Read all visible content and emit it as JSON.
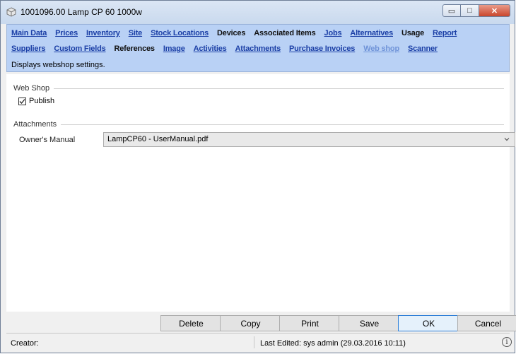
{
  "window": {
    "title": "1001096.00 Lamp CP 60 1000w",
    "controls": {
      "minimize": "▭",
      "maximize": "□",
      "close": "✕"
    }
  },
  "nav": {
    "row1": [
      {
        "label": "Main Data",
        "style": "link"
      },
      {
        "label": "Prices",
        "style": "link"
      },
      {
        "label": "Inventory",
        "style": "link"
      },
      {
        "label": "Site",
        "style": "link"
      },
      {
        "label": "Stock Locations",
        "style": "link"
      },
      {
        "label": "Devices",
        "style": "plain"
      },
      {
        "label": "Associated Items",
        "style": "plain"
      },
      {
        "label": "Jobs",
        "style": "link"
      },
      {
        "label": "Alternatives",
        "style": "link"
      },
      {
        "label": "Usage",
        "style": "plain"
      },
      {
        "label": "Report",
        "style": "link"
      }
    ],
    "row2": [
      {
        "label": "Suppliers",
        "style": "link"
      },
      {
        "label": "Custom Fields",
        "style": "link"
      },
      {
        "label": "References",
        "style": "plain"
      },
      {
        "label": "Image",
        "style": "link"
      },
      {
        "label": "Activities",
        "style": "link"
      },
      {
        "label": "Attachments",
        "style": "link"
      },
      {
        "label": "Purchase Invoices",
        "style": "link"
      },
      {
        "label": "Web shop",
        "style": "current"
      },
      {
        "label": "Scanner",
        "style": "link"
      }
    ],
    "description": "Displays webshop settings."
  },
  "webshop": {
    "group_label": "Web Shop",
    "publish_label": "Publish",
    "publish_checked": true
  },
  "attachments": {
    "group_label": "Attachments",
    "owner_manual_label": "Owner's Manual",
    "owner_manual_value": "LampCP60 - UserManual.pdf"
  },
  "buttons": {
    "delete": "Delete",
    "copy": "Copy",
    "print": "Print",
    "save": "Save",
    "ok": "OK",
    "cancel": "Cancel"
  },
  "status": {
    "creator": "Creator:",
    "last_edited": "Last Edited:  sys admin (29.03.2016 10:11)"
  }
}
